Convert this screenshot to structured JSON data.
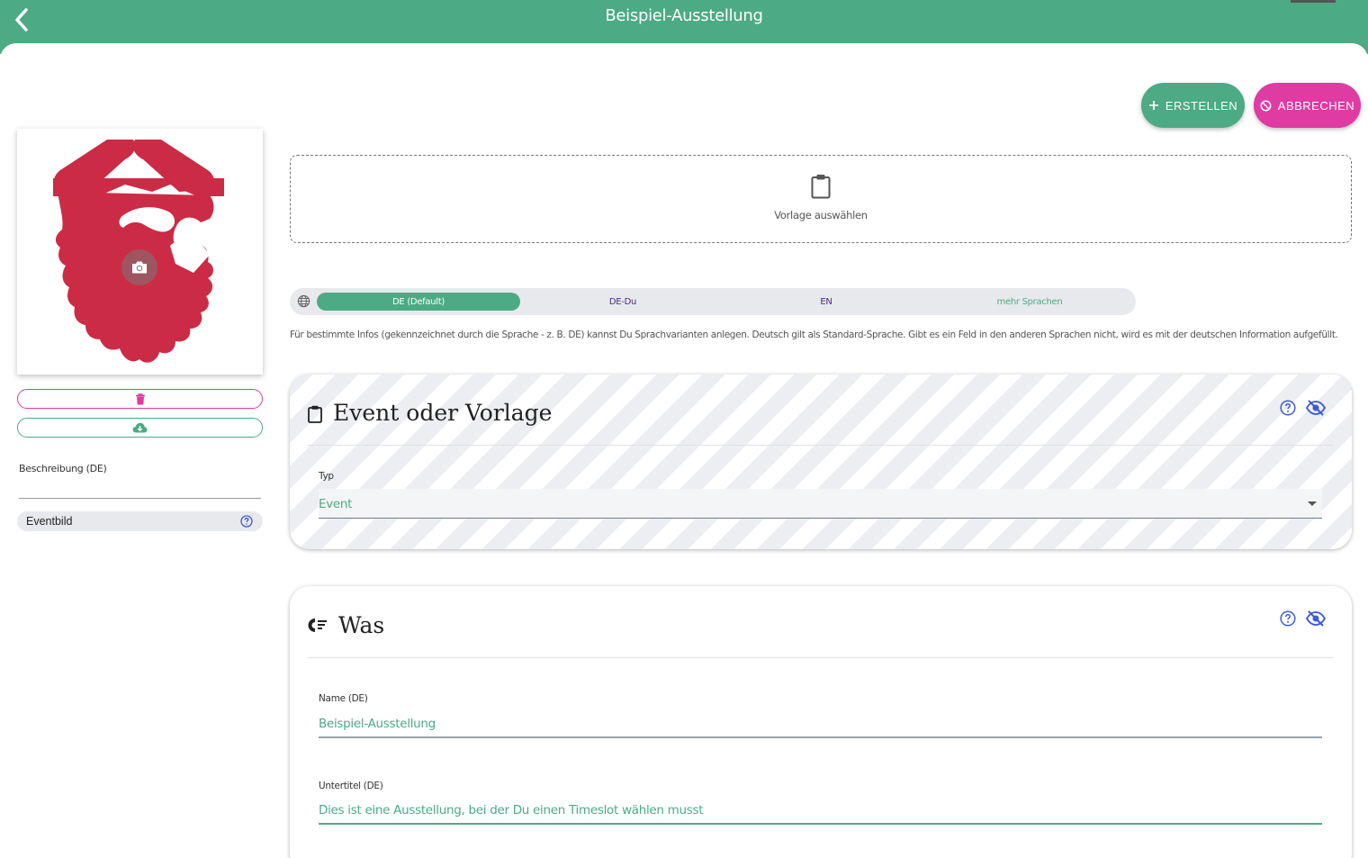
{
  "header": {
    "title": "Beispiel-Ausstellung",
    "back_icon": "chevron-left-icon"
  },
  "actions": {
    "create_label": "ERSTELLEN",
    "cancel_label": "ABBRECHEN"
  },
  "sidebar": {
    "description_label": "Beschreibung (DE)",
    "description_value": "",
    "eventbild_label": "Eventbild"
  },
  "template_picker": {
    "label": "Vorlage auswählen"
  },
  "languages": {
    "tabs": [
      "DE (Default)",
      "DE-Du",
      "EN",
      "mehr Sprachen"
    ],
    "active": 0,
    "hint": "Für bestimmte Infos (gekennzeichnet durch die Sprache - z. B. DE) kannst Du Sprachvarianten anlegen. Deutsch gilt als Standard-Sprache. Gibt es ein Feld in den anderen Sprachen nicht, wird es mit der deutschen Information aufgefüllt."
  },
  "section_event": {
    "title": "Event oder Vorlage",
    "type_label": "Typ",
    "type_value": "Event"
  },
  "section_was": {
    "title": "Was",
    "name_label": "Name (DE)",
    "name_value": "Beispiel-Ausstellung",
    "subtitle_label": "Untertitel (DE)",
    "subtitle_value": "Dies ist eine Ausstellung, bei der Du einen Timeslot wählen musst"
  },
  "colors": {
    "primary": "#4caa84",
    "accent": "#e03aa3",
    "logo": "#cc2b45",
    "help": "#3e5bd6"
  }
}
